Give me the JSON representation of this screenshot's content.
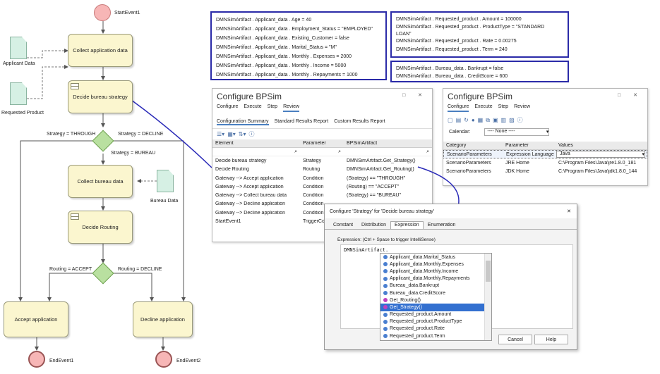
{
  "diagram": {
    "start_event": "StartEvent1",
    "tasks": {
      "collect_application": "Collect application data",
      "decide_bureau": "Decide bureau strategy",
      "collect_bureau": "Collect bureau data",
      "decide_routing": "Decide Routing",
      "accept": "Accept application",
      "decline": "Decline application"
    },
    "data_objects": {
      "applicant": "Applicant Data",
      "requested": "Requested Product",
      "bureau": "Bureau Data"
    },
    "flows": {
      "through": "Strategy = THROUGH",
      "decline": "Strategy = DECLINE",
      "bureau": "Strategy = BUREAU",
      "accept": "Routing = ACCEPT",
      "rdecline": "Routing = DECLINE"
    },
    "end_events": [
      "EndEvent1",
      "EndEvent2"
    ]
  },
  "applicant_box": [
    "DMNSimArtifact . Applicant_data . Age = 40",
    "DMNSimArtifact . Applicant_data . Employment_Status = \"EMPLOYED\"",
    "DMNSimArtifact . Applicant_data . Existing_Customer = false",
    "DMNSimArtifact . Applicant_data . Marital_Status = \"M\"",
    "DMNSimArtifact . Applicant_data . Monthly . Expenses = 2000",
    "DMNSimArtifact . Applicant_data . Monthly . Income = 5000",
    "DMNSimArtifact . Applicant_data . Monthly . Repayments = 1000"
  ],
  "product_box": [
    "DMNSimArtifact . Requested_product . Amount = 100000",
    "DMNSimArtifact . Requested_product . ProductType = \"STANDARD",
    "LOAN\"",
    "DMNSimArtifact . Requested_product . Rate = 0.00275",
    "DMNSimArtifact . Requested_product . Term = 240"
  ],
  "bureau_box": [
    "DMNSimArtifact . Bureau_data . Bankrupt = false",
    "DMNSimArtifact . Bureau_data . CreditScore = 600"
  ],
  "bpsim1": {
    "title": "Configure BPSim",
    "window_buttons": "□ ✕",
    "menu": [
      "Configure",
      "Execute",
      "Step",
      "Review"
    ],
    "tabs": [
      "Configuration Summary",
      "Standard Results Report",
      "Custom Results Report"
    ],
    "columns": [
      "Element",
      "Parameter",
      "BPSimArtifact"
    ],
    "rows": [
      [
        "Decide bureau strategy",
        "Strategy",
        "DMNSimArtifact.Get_Strategy()"
      ],
      [
        "Decide Routing",
        "Routing",
        "DMNSimArtifact.Get_Routing()"
      ],
      [
        "Gateway --> Accept application",
        "Condition",
        "(Strategy) == \"THROUGH\""
      ],
      [
        "Gateway --> Accept application",
        "Condition",
        "(Routing) == \"ACCEPT\""
      ],
      [
        "Gateway --> Collect bureau data",
        "Condition",
        "(Strategy) == \"BUREAU\""
      ],
      [
        "Gateway --> Decline application",
        "Condition",
        ""
      ],
      [
        "Gateway --> Decline application",
        "Condition",
        ""
      ],
      [
        "StartEvent1",
        "TriggerCo",
        ""
      ]
    ]
  },
  "bpsim2": {
    "title": "Configure BPSim",
    "window_buttons": "□ ✕",
    "menu": [
      "Configure",
      "Execute",
      "Step",
      "Review"
    ],
    "calendar_label": "Calendar:",
    "calendar_value": "---- None ----",
    "columns": [
      "Category",
      "Parameter",
      "Values"
    ],
    "rows": [
      [
        "ScenarioParameters",
        "Expression Language",
        "Java"
      ],
      [
        "ScenarioParameters",
        "JRE Home",
        "C:\\Program Files\\Java\\jre1.8.0_181"
      ],
      [
        "ScenarioParameters",
        "JDK Home",
        "C:\\Program Files\\Java\\jdk1.8.0_144"
      ]
    ]
  },
  "dialog": {
    "title": "Configure 'Strategy' for 'Decide bureau strategy'",
    "close": "✕",
    "tabs": [
      "Constant",
      "Distribution",
      "Expression",
      "Enumeration"
    ],
    "hint": "Expression: (Ctrl + Space to trigger IntelliSense)",
    "editor_text": "DMNSimArtifact.",
    "items": [
      "Applicant_data.Marital_Status",
      "Applicant_data.Monthly.Expenses",
      "Applicant_data.Monthly.Income",
      "Applicant_data.Monthly.Repayments",
      "Bureau_data.Bankrupt",
      "Bureau_data.CreditScore",
      "Get_Routing()",
      "Get_Strategy()",
      "Requested_product.Amount",
      "Requested_product.ProductType",
      "Requested_product.Rate",
      "Requested_product.Term"
    ],
    "selected_item": "Get_Strategy()",
    "buttons": {
      "cancel": "Cancel",
      "help": "Help"
    }
  }
}
